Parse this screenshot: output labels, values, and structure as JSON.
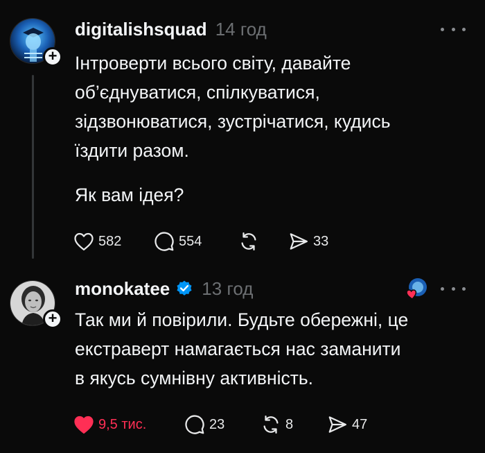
{
  "posts": [
    {
      "username": "digitalishsquad",
      "verified": false,
      "time": "14 год",
      "text_lines": [
        "Інтроверти всього світу, давайте",
        "об’єднуватися, спілкуватися,",
        "зідзвонюватися, зустрічатися, кудись",
        "їздити разом."
      ],
      "text_para2": "Як вам ідея?",
      "likes": "582",
      "comments": "554",
      "reposts": "",
      "shares": "33",
      "liked": false
    },
    {
      "username": "monokatee",
      "verified": true,
      "time": "13 год",
      "text_lines": [
        "Так ми й повірили. Будьте обережні, це",
        "екстраверт намагається нас заманити",
        "в якусь сумнівну активність."
      ],
      "likes": "9,5 тис.",
      "comments": "23",
      "reposts": "8",
      "shares": "47",
      "liked": true
    }
  ],
  "colors": {
    "background": "#0a0a0a",
    "text": "#f3f5f7",
    "muted": "#6c6f72",
    "like_red": "#ff2f55",
    "verified_blue": "#0095f6"
  },
  "icons": [
    "heart-icon",
    "comment-icon",
    "repost-icon",
    "share-icon",
    "more-icon",
    "verified-icon",
    "plus-icon"
  ]
}
